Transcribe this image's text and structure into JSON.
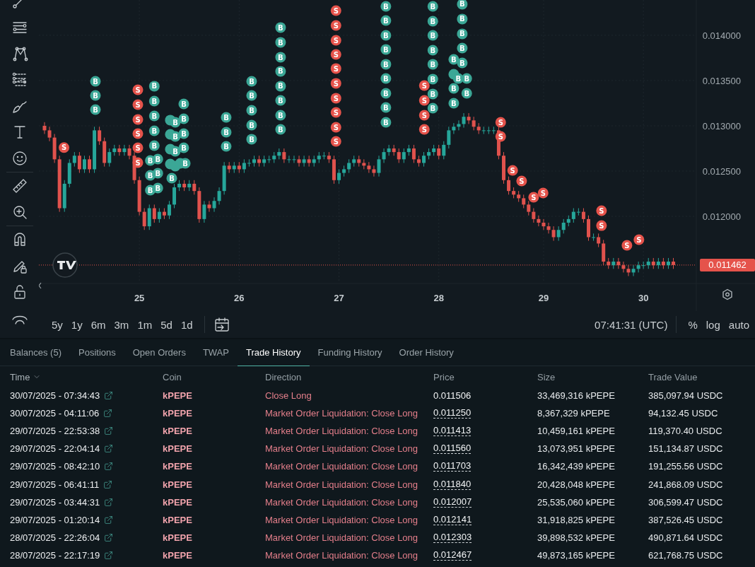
{
  "chart": {
    "chart_data": {
      "type": "candlestick",
      "grid": true,
      "categories": [
        null,
        null,
        null,
        null,
        null,
        null,
        null,
        null,
        null,
        null,
        null,
        null,
        null,
        null,
        null,
        null,
        null,
        null,
        null,
        "25",
        null,
        null,
        null,
        null,
        null,
        null,
        null,
        null,
        null,
        null,
        null,
        null,
        null,
        null,
        null,
        null,
        null,
        null,
        null,
        "26",
        null,
        null,
        null,
        null,
        null,
        null,
        null,
        null,
        null,
        null,
        null,
        null,
        null,
        null,
        null,
        null,
        null,
        null,
        null,
        "27",
        null,
        null,
        null,
        null,
        null,
        null,
        null,
        null,
        null,
        null,
        null,
        null,
        null,
        null,
        null,
        null,
        null,
        null,
        null,
        "28",
        null,
        null,
        null,
        null,
        null,
        null,
        null,
        null,
        null,
        null,
        null,
        null,
        null,
        null,
        null,
        null,
        null,
        null,
        null,
        null,
        "29",
        null,
        null,
        null,
        null,
        null,
        null,
        null,
        null,
        null,
        null,
        null,
        null,
        null,
        null,
        null,
        null,
        null,
        null,
        null,
        "30",
        null,
        null,
        null,
        null,
        null,
        null
      ],
      "ylim": [
        0.011266,
        0.01439
      ],
      "yticks": [
        {
          "value": 0.012,
          "label": "0.012000"
        },
        {
          "value": 0.0125,
          "label": "0.012500"
        },
        {
          "value": 0.013,
          "label": "0.013000"
        },
        {
          "value": 0.0135,
          "label": "0.013500"
        },
        {
          "value": 0.014,
          "label": "0.014000"
        }
      ],
      "ohlc": [
        [
          0.013,
          0.01304,
          0.01291,
          0.01295
        ],
        [
          0.01295,
          0.01299,
          0.01283,
          0.01287
        ],
        [
          0.01287,
          0.01291,
          0.01259,
          0.01263
        ],
        [
          0.01263,
          0.01267,
          0.01205,
          0.01209
        ],
        [
          0.01209,
          0.0124,
          0.01205,
          0.01236
        ],
        [
          0.01236,
          0.01263,
          0.01232,
          0.01259
        ],
        [
          0.01259,
          0.01271,
          0.01255,
          0.01267
        ],
        [
          0.01267,
          0.01271,
          0.01248,
          0.01252
        ],
        [
          0.01252,
          0.01267,
          0.01248,
          0.01263
        ],
        [
          0.01263,
          0.01267,
          0.01248,
          0.01252
        ],
        [
          0.01252,
          0.01299,
          0.01248,
          0.01295
        ],
        [
          0.01295,
          0.01299,
          0.01279,
          0.01283
        ],
        [
          0.01283,
          0.01287,
          0.01255,
          0.01259
        ],
        [
          0.01259,
          0.01275,
          0.01255,
          0.01271
        ],
        [
          0.01271,
          0.01279,
          0.01267,
          0.01275
        ],
        [
          0.01275,
          0.01279,
          0.01267,
          0.01271
        ],
        [
          0.01271,
          0.01279,
          0.01267,
          0.01275
        ],
        [
          0.01275,
          0.01279,
          0.01263,
          0.01267
        ],
        [
          0.01267,
          0.01271,
          0.01236,
          0.0124
        ],
        [
          0.0124,
          0.01244,
          0.01201,
          0.01205
        ],
        [
          0.01205,
          0.01209,
          0.01185,
          0.01189
        ],
        [
          0.01189,
          0.01213,
          0.01185,
          0.01209
        ],
        [
          0.01209,
          0.01213,
          0.01193,
          0.01197
        ],
        [
          0.01197,
          0.01209,
          0.01193,
          0.01205
        ],
        [
          0.01205,
          0.01209,
          0.01197,
          0.01201
        ],
        [
          0.01201,
          0.01217,
          0.01197,
          0.01213
        ],
        [
          0.01213,
          0.01236,
          0.01209,
          0.01232
        ],
        [
          0.01232,
          0.0124,
          0.01228,
          0.01236
        ],
        [
          0.01236,
          0.0124,
          0.01228,
          0.01232
        ],
        [
          0.01232,
          0.0124,
          0.01228,
          0.01236
        ],
        [
          0.01236,
          0.0124,
          0.01224,
          0.01228
        ],
        [
          0.01228,
          0.01232,
          0.01193,
          0.01197
        ],
        [
          0.01197,
          0.01217,
          0.01193,
          0.01213
        ],
        [
          0.01213,
          0.01217,
          0.01205,
          0.01209
        ],
        [
          0.01209,
          0.01221,
          0.01205,
          0.01217
        ],
        [
          0.01217,
          0.01232,
          0.01213,
          0.01228
        ],
        [
          0.01228,
          0.0126,
          0.01224,
          0.01256
        ],
        [
          0.01256,
          0.0126,
          0.01248,
          0.01252
        ],
        [
          0.01252,
          0.0126,
          0.01248,
          0.01256
        ],
        [
          0.01256,
          0.0126,
          0.01248,
          0.01252
        ],
        [
          0.01252,
          0.01263,
          0.01248,
          0.01259
        ],
        [
          0.01259,
          0.01263,
          0.01255,
          0.01259
        ],
        [
          0.01259,
          0.01267,
          0.01255,
          0.01263
        ],
        [
          0.01263,
          0.01267,
          0.01255,
          0.01259
        ],
        [
          0.01259,
          0.01267,
          0.01255,
          0.01263
        ],
        [
          0.01263,
          0.01267,
          0.01259,
          0.01263
        ],
        [
          0.01263,
          0.01271,
          0.01259,
          0.01267
        ],
        [
          0.01267,
          0.01275,
          0.01263,
          0.01271
        ],
        [
          0.01271,
          0.01275,
          0.01259,
          0.01263
        ],
        [
          0.01263,
          0.01267,
          0.01259,
          0.01263
        ],
        [
          0.01263,
          0.01267,
          0.01259,
          0.01263
        ],
        [
          0.01263,
          0.01267,
          0.01255,
          0.01259
        ],
        [
          0.01259,
          0.01267,
          0.01255,
          0.01263
        ],
        [
          0.01263,
          0.01267,
          0.01255,
          0.01259
        ],
        [
          0.01259,
          0.01267,
          0.01255,
          0.01263
        ],
        [
          0.01263,
          0.01271,
          0.01259,
          0.01267
        ],
        [
          0.01267,
          0.01271,
          0.01263,
          0.01267
        ],
        [
          0.01267,
          0.01271,
          0.01259,
          0.01263
        ],
        [
          0.01263,
          0.01267,
          0.01236,
          0.0124
        ],
        [
          0.0124,
          0.01252,
          0.01236,
          0.01248
        ],
        [
          0.01248,
          0.01256,
          0.01244,
          0.01252
        ],
        [
          0.01252,
          0.01263,
          0.01248,
          0.01259
        ],
        [
          0.01259,
          0.01267,
          0.01255,
          0.01263
        ],
        [
          0.01263,
          0.01267,
          0.01255,
          0.01259
        ],
        [
          0.01259,
          0.01263,
          0.01252,
          0.01256
        ],
        [
          0.01256,
          0.0126,
          0.01248,
          0.01252
        ],
        [
          0.01252,
          0.01256,
          0.01244,
          0.01248
        ],
        [
          0.01248,
          0.01267,
          0.01244,
          0.01263
        ],
        [
          0.01263,
          0.01275,
          0.01259,
          0.01271
        ],
        [
          0.01271,
          0.01279,
          0.01267,
          0.01275
        ],
        [
          0.01275,
          0.01279,
          0.01267,
          0.01271
        ],
        [
          0.01271,
          0.01275,
          0.01259,
          0.01263
        ],
        [
          0.01263,
          0.01275,
          0.01259,
          0.01271
        ],
        [
          0.01271,
          0.01279,
          0.01267,
          0.01275
        ],
        [
          0.01275,
          0.01279,
          0.01259,
          0.01263
        ],
        [
          0.01263,
          0.01267,
          0.01255,
          0.01259
        ],
        [
          0.01259,
          0.01271,
          0.01255,
          0.01267
        ],
        [
          0.01267,
          0.01275,
          0.01263,
          0.01271
        ],
        [
          0.01271,
          0.01279,
          0.01267,
          0.01275
        ],
        [
          0.01275,
          0.01279,
          0.01263,
          0.01267
        ],
        [
          0.01267,
          0.01283,
          0.01263,
          0.01279
        ],
        [
          0.01279,
          0.01299,
          0.01275,
          0.01295
        ],
        [
          0.01295,
          0.01303,
          0.01291,
          0.01299
        ],
        [
          0.01299,
          0.01306,
          0.01295,
          0.01302
        ],
        [
          0.01302,
          0.01314,
          0.01298,
          0.0131
        ],
        [
          0.0131,
          0.01314,
          0.01302,
          0.01306
        ],
        [
          0.01306,
          0.0131,
          0.01295,
          0.01299
        ],
        [
          0.01299,
          0.01303,
          0.01291,
          0.01295
        ],
        [
          0.01295,
          0.01299,
          0.01291,
          0.01295
        ],
        [
          0.01295,
          0.01299,
          0.01291,
          0.01295
        ],
        [
          0.01295,
          0.01299,
          0.01291,
          0.01295
        ],
        [
          0.01295,
          0.01299,
          0.01263,
          0.01267
        ],
        [
          0.01267,
          0.01271,
          0.01236,
          0.0124
        ],
        [
          0.0124,
          0.01244,
          0.01224,
          0.01228
        ],
        [
          0.01228,
          0.01232,
          0.0122,
          0.01224
        ],
        [
          0.01224,
          0.01228,
          0.01216,
          0.0122
        ],
        [
          0.0122,
          0.01224,
          0.01209,
          0.01213
        ],
        [
          0.01213,
          0.01217,
          0.01201,
          0.01205
        ],
        [
          0.01205,
          0.01209,
          0.01193,
          0.01197
        ],
        [
          0.01197,
          0.01201,
          0.01189,
          0.01193
        ],
        [
          0.01193,
          0.01197,
          0.01185,
          0.01189
        ],
        [
          0.01189,
          0.01193,
          0.01181,
          0.01185
        ],
        [
          0.01185,
          0.01189,
          0.01173,
          0.01177
        ],
        [
          0.01177,
          0.01189,
          0.01173,
          0.01185
        ],
        [
          0.01185,
          0.01197,
          0.01181,
          0.01193
        ],
        [
          0.01193,
          0.01201,
          0.01189,
          0.01197
        ],
        [
          0.01197,
          0.01209,
          0.01193,
          0.01205
        ],
        [
          0.01205,
          0.01209,
          0.01201,
          0.01205
        ],
        [
          0.01205,
          0.01209,
          0.01193,
          0.01197
        ],
        [
          0.01197,
          0.01201,
          0.01173,
          0.01177
        ],
        [
          0.01177,
          0.01181,
          0.01173,
          0.01177
        ],
        [
          0.01177,
          0.01181,
          0.01166,
          0.0117
        ],
        [
          0.0117,
          0.01174,
          0.01146,
          0.0115
        ],
        [
          0.0115,
          0.01154,
          0.01142,
          0.01146
        ],
        [
          0.01146,
          0.01154,
          0.01142,
          0.0115
        ],
        [
          0.0115,
          0.01154,
          0.01142,
          0.01146
        ],
        [
          0.01146,
          0.0115,
          0.01138,
          0.01142
        ],
        [
          0.01142,
          0.01146,
          0.01134,
          0.01138
        ],
        [
          0.01138,
          0.01146,
          0.01134,
          0.01142
        ],
        [
          0.01142,
          0.0115,
          0.01138,
          0.01146
        ],
        [
          0.01146,
          0.0115,
          0.01142,
          0.01146
        ],
        [
          0.01146,
          0.01154,
          0.01142,
          0.0115
        ],
        [
          0.0115,
          0.01154,
          0.01142,
          0.01146
        ],
        [
          0.01146,
          0.01154,
          0.01142,
          0.0115
        ],
        [
          0.0115,
          0.01154,
          0.01142,
          0.01146
        ],
        [
          0.01146,
          0.01154,
          0.01142,
          0.0115
        ],
        [
          0.0115,
          0.01154,
          0.01142,
          0.011462
        ]
      ],
      "ref_lines": [
        {
          "axis": "y",
          "value": 0.011462,
          "label": "0.011462"
        }
      ]
    },
    "trade_markers": [
      {
        "text": "S",
        "color": "#e5534b"
      },
      {
        "text": "B",
        "color": "#3ba796"
      },
      {
        "text": "B",
        "color": "#3ba796"
      },
      {
        "text": "B",
        "color": "#3ba796"
      },
      {
        "text": "S",
        "color": "#e5534b"
      },
      {
        "text": "S",
        "color": "#e5534b"
      },
      {
        "text": "S",
        "color": "#e5534b"
      },
      {
        "text": "S",
        "color": "#e5534b"
      },
      {
        "text": "S",
        "color": "#e5534b"
      },
      {
        "text": "S",
        "color": "#e5534b"
      },
      {
        "text": "B",
        "color": "#3ba796"
      },
      {
        "text": "B",
        "color": "#3ba796"
      },
      {
        "text": "B",
        "color": "#3ba796"
      },
      {
        "text": "B",
        "color": "#3ba796"
      },
      {
        "text": "B",
        "color": "#3ba796"
      },
      {
        "text": "B",
        "color": "#3ba796"
      },
      {
        "text": "B",
        "color": "#3ba796"
      },
      {
        "text": "B",
        "color": "#3ba796"
      },
      {
        "text": "B",
        "color": "#3ba796"
      },
      {
        "text": "B",
        "color": "#3ba796"
      },
      {
        "text": "B",
        "color": "#3ba796"
      },
      {
        "color": "#3ba796"
      },
      {
        "text": "B",
        "color": "#3ba796"
      },
      {
        "color": "#3ba796"
      },
      {
        "text": "B",
        "color": "#3ba796"
      },
      {
        "color": "#3ba796"
      },
      {
        "text": "B",
        "color": "#3ba796"
      },
      {
        "color": "#3ba796"
      },
      {
        "color": "#3ba796"
      },
      {
        "text": "B",
        "color": "#3ba796"
      },
      {
        "text": "B",
        "color": "#3ba796"
      },
      {
        "text": "B",
        "color": "#3ba796"
      },
      {
        "text": "B",
        "color": "#3ba796"
      },
      {
        "text": "B",
        "color": "#3ba796"
      },
      {
        "color": "#3ba796"
      },
      {
        "text": "B",
        "color": "#3ba796"
      },
      {
        "text": "B",
        "color": "#3ba796"
      },
      {
        "text": "B",
        "color": "#3ba796"
      },
      {
        "text": "B",
        "color": "#3ba796"
      },
      {
        "text": "B",
        "color": "#3ba796"
      },
      {
        "text": "B",
        "color": "#3ba796"
      },
      {
        "text": "B",
        "color": "#3ba796"
      },
      {
        "text": "B",
        "color": "#3ba796"
      },
      {
        "text": "B",
        "color": "#3ba796"
      },
      {
        "text": "B",
        "color": "#3ba796"
      },
      {
        "text": "B",
        "color": "#3ba796"
      },
      {
        "text": "B",
        "color": "#3ba796"
      },
      {
        "text": "B",
        "color": "#3ba796"
      },
      {
        "text": "B",
        "color": "#3ba796"
      },
      {
        "text": "B",
        "color": "#3ba796"
      },
      {
        "text": "B",
        "color": "#3ba796"
      },
      {
        "text": "B",
        "color": "#3ba796"
      },
      {
        "text": "S",
        "color": "#e5534b"
      },
      {
        "text": "S",
        "color": "#e5534b"
      },
      {
        "text": "S",
        "color": "#e5534b"
      },
      {
        "text": "S",
        "color": "#e5534b"
      },
      {
        "text": "S",
        "color": "#e5534b"
      },
      {
        "text": "S",
        "color": "#e5534b"
      },
      {
        "text": "S",
        "color": "#e5534b"
      },
      {
        "text": "S",
        "color": "#e5534b"
      },
      {
        "text": "S",
        "color": "#e5534b"
      },
      {
        "text": "S",
        "color": "#e5534b"
      },
      {
        "text": "B",
        "color": "#3ba796"
      },
      {
        "text": "B",
        "color": "#3ba796"
      },
      {
        "text": "B",
        "color": "#3ba796"
      },
      {
        "text": "B",
        "color": "#3ba796"
      },
      {
        "text": "B",
        "color": "#3ba796"
      },
      {
        "text": "B",
        "color": "#3ba796"
      },
      {
        "text": "B",
        "color": "#3ba796"
      },
      {
        "text": "B",
        "color": "#3ba796"
      },
      {
        "text": "B",
        "color": "#3ba796"
      },
      {
        "text": "S",
        "color": "#e5534b"
      },
      {
        "text": "S",
        "color": "#e5534b"
      },
      {
        "text": "S",
        "color": "#e5534b"
      },
      {
        "text": "S",
        "color": "#e5534b"
      },
      {
        "text": "B",
        "color": "#3ba796"
      },
      {
        "text": "B",
        "color": "#3ba796"
      },
      {
        "text": "B",
        "color": "#3ba796"
      },
      {
        "text": "B",
        "color": "#3ba796"
      },
      {
        "text": "B",
        "color": "#3ba796"
      },
      {
        "text": "B",
        "color": "#3ba796"
      },
      {
        "text": "B",
        "color": "#3ba796"
      },
      {
        "text": "B",
        "color": "#3ba796"
      },
      {
        "text": "B",
        "color": "#3ba796"
      },
      {
        "color": "#3ba796"
      },
      {
        "text": "B",
        "color": "#3ba796"
      },
      {
        "text": "B",
        "color": "#3ba796"
      },
      {
        "text": "B",
        "color": "#3ba796"
      },
      {
        "text": "B",
        "color": "#3ba796"
      },
      {
        "text": "B",
        "color": "#3ba796"
      },
      {
        "text": "B",
        "color": "#3ba796"
      },
      {
        "text": "B",
        "color": "#3ba796"
      },
      {
        "text": "B",
        "color": "#3ba796"
      },
      {
        "text": "B",
        "color": "#3ba796"
      },
      {
        "text": "B",
        "color": "#3ba796"
      },
      {
        "text": "S",
        "color": "#e5534b"
      },
      {
        "text": "S",
        "color": "#e5534b"
      },
      {
        "text": "S",
        "color": "#e5534b"
      },
      {
        "text": "S",
        "color": "#e5534b"
      },
      {
        "text": "S",
        "color": "#e5534b"
      },
      {
        "text": "S",
        "color": "#e5534b"
      },
      {
        "text": "S",
        "color": "#e5534b"
      },
      {
        "text": "S",
        "color": "#e5534b"
      },
      {
        "text": "S",
        "color": "#e5534b"
      },
      {
        "text": "S",
        "color": "#e5534b"
      }
    ]
  },
  "range_buttons": [
    "5y",
    "1y",
    "6m",
    "3m",
    "1m",
    "5d",
    "1d"
  ],
  "clock": "07:41:31 (UTC)",
  "scale_buttons": [
    "%",
    "log",
    "auto"
  ],
  "tabs": [
    {
      "label": "Balances (5)",
      "selected": false
    },
    {
      "label": "Positions",
      "selected": false
    },
    {
      "label": "Open Orders",
      "selected": false
    },
    {
      "label": "TWAP",
      "selected": false
    },
    {
      "label": "Trade History",
      "selected": true
    },
    {
      "label": "Funding History",
      "selected": false
    },
    {
      "label": "Order History",
      "selected": false
    }
  ],
  "table": {
    "columns": [
      {
        "label": "Time",
        "sorted": true
      },
      {
        "label": "Coin",
        "sorted": false
      },
      {
        "label": "Direction",
        "sorted": false
      },
      {
        "label": "Price",
        "sorted": false
      },
      {
        "label": "Size",
        "sorted": false
      },
      {
        "label": "Trade Value",
        "sorted": false
      }
    ],
    "rows": [
      {
        "time": "30/07/2025 - 07:34:43",
        "coin": "kPEPE",
        "direction": "Close Long",
        "price": "0.011506",
        "price_underlined": false,
        "size": "33,469,316 kPEPE",
        "trade_value": "385,097.94 USDC"
      },
      {
        "time": "30/07/2025 - 04:11:06",
        "coin": "kPEPE",
        "direction": "Market Order Liquidation: Close Long",
        "price": "0.011250",
        "price_underlined": true,
        "size": "8,367,329 kPEPE",
        "trade_value": "94,132.45 USDC"
      },
      {
        "time": "29/07/2025 - 22:53:38",
        "coin": "kPEPE",
        "direction": "Market Order Liquidation: Close Long",
        "price": "0.011413",
        "price_underlined": true,
        "size": "10,459,161 kPEPE",
        "trade_value": "119,370.40 USDC"
      },
      {
        "time": "29/07/2025 - 22:04:14",
        "coin": "kPEPE",
        "direction": "Market Order Liquidation: Close Long",
        "price": "0.011560",
        "price_underlined": true,
        "size": "13,073,951 kPEPE",
        "trade_value": "151,134.87 USDC"
      },
      {
        "time": "29/07/2025 - 08:42:10",
        "coin": "kPEPE",
        "direction": "Market Order Liquidation: Close Long",
        "price": "0.011703",
        "price_underlined": true,
        "size": "16,342,439 kPEPE",
        "trade_value": "191,255.56 USDC"
      },
      {
        "time": "29/07/2025 - 06:41:11",
        "coin": "kPEPE",
        "direction": "Market Order Liquidation: Close Long",
        "price": "0.011840",
        "price_underlined": true,
        "size": "20,428,048 kPEPE",
        "trade_value": "241,868.09 USDC"
      },
      {
        "time": "29/07/2025 - 03:44:31",
        "coin": "kPEPE",
        "direction": "Market Order Liquidation: Close Long",
        "price": "0.012007",
        "price_underlined": true,
        "size": "25,535,060 kPEPE",
        "trade_value": "306,599.47 USDC"
      },
      {
        "time": "29/07/2025 - 01:20:14",
        "coin": "kPEPE",
        "direction": "Market Order Liquidation: Close Long",
        "price": "0.012141",
        "price_underlined": true,
        "size": "31,918,825 kPEPE",
        "trade_value": "387,526.45 USDC"
      },
      {
        "time": "28/07/2025 - 22:26:04",
        "coin": "kPEPE",
        "direction": "Market Order Liquidation: Close Long",
        "price": "0.012303",
        "price_underlined": true,
        "size": "39,898,532 kPEPE",
        "trade_value": "490,871.64 USDC"
      },
      {
        "time": "28/07/2025 - 22:17:19",
        "coin": "kPEPE",
        "direction": "Market Order Liquidation: Close Long",
        "price": "0.012467",
        "price_underlined": true,
        "size": "49,873,165 kPEPE",
        "trade_value": "621,768.75 USDC"
      }
    ]
  }
}
